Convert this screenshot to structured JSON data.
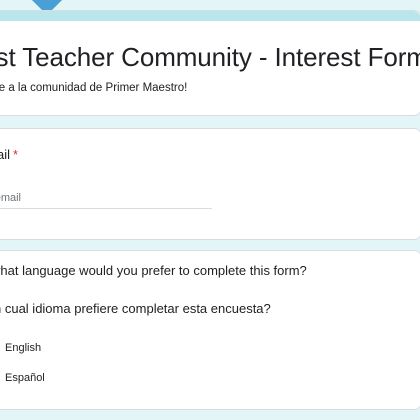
{
  "form": {
    "title": "rst Teacher Community - Interest Form",
    "description": "se a la comunidad de Primer Maestro!"
  },
  "email_question": {
    "label": "ail",
    "required_mark": "*",
    "placeholder": "r email"
  },
  "language_question": {
    "question_en": "what language would you prefer to complete this form?",
    "question_es": "n cual idioma prefiere completar esta encuesta?",
    "options": [
      {
        "label": "English"
      },
      {
        "label": "Español"
      }
    ]
  },
  "colors": {
    "background": "#e3f5f7",
    "accent": "#b8e6ea",
    "required": "#d93025"
  }
}
